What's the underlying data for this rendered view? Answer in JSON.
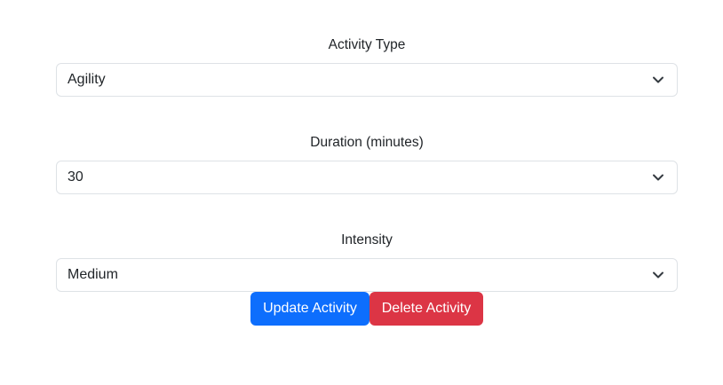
{
  "form": {
    "activity_type": {
      "label": "Activity Type",
      "value": "Agility"
    },
    "duration": {
      "label": "Duration (minutes)",
      "value": "30"
    },
    "intensity": {
      "label": "Intensity",
      "value": "Medium"
    }
  },
  "actions": {
    "update_label": "Update Activity",
    "delete_label": "Delete Activity"
  },
  "icons": {
    "select_chevron": "chevron-down-icon"
  },
  "colors": {
    "primary": "#0d6efd",
    "danger": "#dc3545",
    "border": "#dee2e6",
    "text": "#212529"
  }
}
